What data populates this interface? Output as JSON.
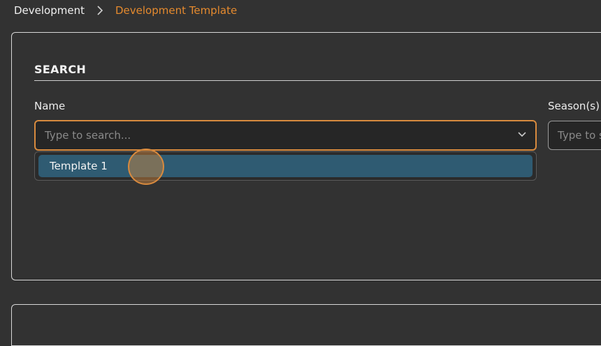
{
  "breadcrumb": {
    "root": "Development",
    "current": "Development Template"
  },
  "search": {
    "title": "SEARCH",
    "name_label": "Name",
    "name_placeholder": "Type to search...",
    "season_label": "Season(s)",
    "season_placeholder": "Type to search..."
  },
  "dropdown": {
    "options": [
      "Template 1"
    ]
  },
  "colors": {
    "accent": "#e58a2e",
    "highlight": "#2f5b72",
    "background": "#323232"
  }
}
